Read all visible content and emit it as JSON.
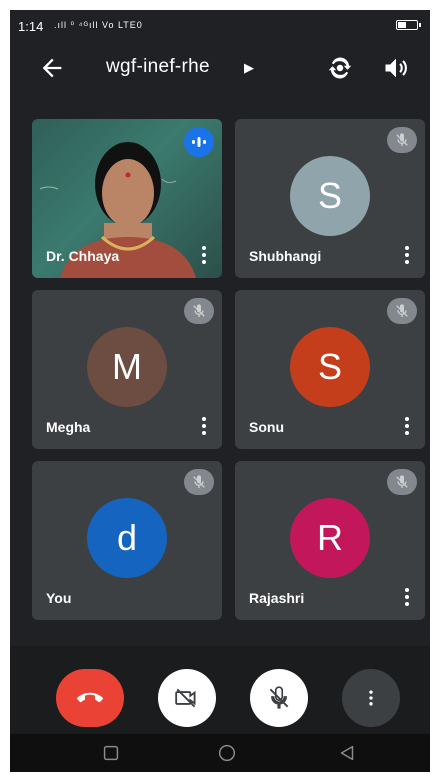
{
  "status_bar": {
    "time": "1:14",
    "signal_text": ".ıll ⁰ ⁴ᴳıll Vo LTE0"
  },
  "header": {
    "meeting_code": "wgf-inef-rhe",
    "icons": [
      "back-arrow-icon",
      "switch-camera-icon",
      "speaker-icon"
    ]
  },
  "participants": [
    {
      "name": "Dr. Chhaya",
      "initial": "",
      "avatar_color": "",
      "video_on": true,
      "speaking": true,
      "muted": false
    },
    {
      "name": "Shubhangi",
      "initial": "S",
      "avatar_color": "#8fa4ab",
      "video_on": false,
      "speaking": false,
      "muted": true
    },
    {
      "name": "Megha",
      "initial": "M",
      "avatar_color": "#6d4c41",
      "video_on": false,
      "speaking": false,
      "muted": true
    },
    {
      "name": "Sonu",
      "initial": "S",
      "avatar_color": "#c53e1b",
      "video_on": false,
      "speaking": false,
      "muted": true
    },
    {
      "name": "You",
      "initial": "d",
      "avatar_color": "#1565c0",
      "video_on": false,
      "speaking": false,
      "muted": true
    },
    {
      "name": "Rajashri",
      "initial": "R",
      "avatar_color": "#c2185b",
      "video_on": false,
      "speaking": false,
      "muted": true
    }
  ],
  "controls": {
    "buttons": [
      "end-call-icon",
      "camera-off-icon",
      "mic-off-icon",
      "more-options-icon"
    ],
    "colors": {
      "end_call": "#ea4335",
      "toggle_bg": "#ffffff",
      "more_bg": "#3c4043"
    }
  },
  "nav_bar": {
    "buttons": [
      "recent-apps-icon",
      "home-icon",
      "back-icon"
    ]
  },
  "theme": {
    "background": "#202124",
    "tile": "#3c4043",
    "speaking_badge": "#1a73e8"
  }
}
